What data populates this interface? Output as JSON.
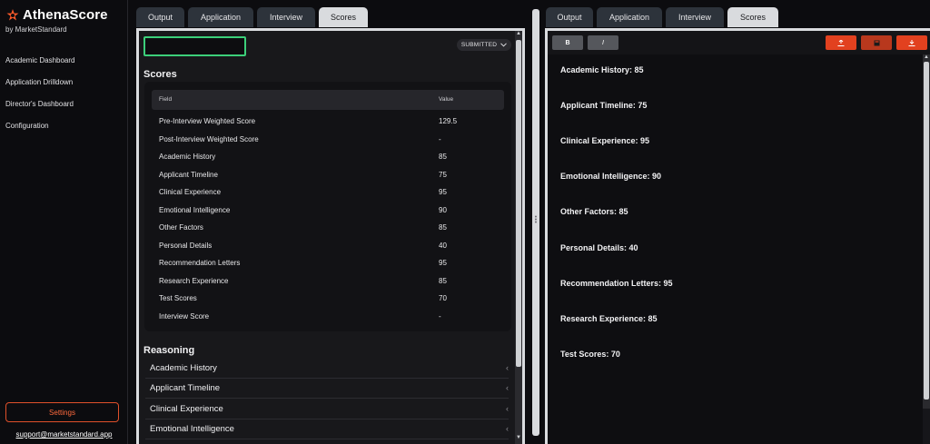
{
  "brand": {
    "name": "AthenaScore",
    "subtitle": "by MarketStandard"
  },
  "nav": [
    "Academic Dashboard",
    "Application Drilldown",
    "Director's Dashboard",
    "Configuration"
  ],
  "settings_label": "Settings",
  "support_email": "support@marketstandard.app",
  "left_tabs": [
    "Output",
    "Application",
    "Interview",
    "Scores"
  ],
  "right_tabs": [
    "Output",
    "Application",
    "Interview",
    "Scores"
  ],
  "active_tab": "Scores",
  "status": {
    "value": "SUBMITTED",
    "input_value": ""
  },
  "scores": {
    "title": "Scores",
    "columns": {
      "field": "Field",
      "value": "Value"
    },
    "rows": [
      {
        "field": "Pre-Interview Weighted Score",
        "value": "129.5"
      },
      {
        "field": "Post-Interview Weighted Score",
        "value": "-"
      },
      {
        "field": "Academic History",
        "value": "85"
      },
      {
        "field": "Applicant Timeline",
        "value": "75"
      },
      {
        "field": "Clinical Experience",
        "value": "95"
      },
      {
        "field": "Emotional Intelligence",
        "value": "90"
      },
      {
        "field": "Other Factors",
        "value": "85"
      },
      {
        "field": "Personal Details",
        "value": "40"
      },
      {
        "field": "Recommendation Letters",
        "value": "95"
      },
      {
        "field": "Research Experience",
        "value": "85"
      },
      {
        "field": "Test Scores",
        "value": "70"
      },
      {
        "field": "Interview Score",
        "value": "-"
      }
    ]
  },
  "reasoning": {
    "title": "Reasoning",
    "items": [
      "Academic History",
      "Applicant Timeline",
      "Clinical Experience",
      "Emotional Intelligence"
    ]
  },
  "editor": {
    "bold_label": "B",
    "italic_label": "I",
    "lines": [
      "Academic History: 85",
      "Applicant Timeline: 75",
      "Clinical Experience: 95",
      "Emotional Intelligence: 90",
      "Other Factors: 85",
      "Personal Details: 40",
      "Recommendation Letters: 95",
      "Research Experience: 85",
      "Test Scores: 70"
    ]
  },
  "colors": {
    "accent": "#e2411f",
    "focus": "#3ccf7a",
    "tab_active": "#d9dbde",
    "tab_inactive": "#2d333b"
  },
  "icons": {
    "brand": "flame-star-icon",
    "chevron": "chevron-left-icon",
    "dropdown": "chevron-down-icon"
  }
}
